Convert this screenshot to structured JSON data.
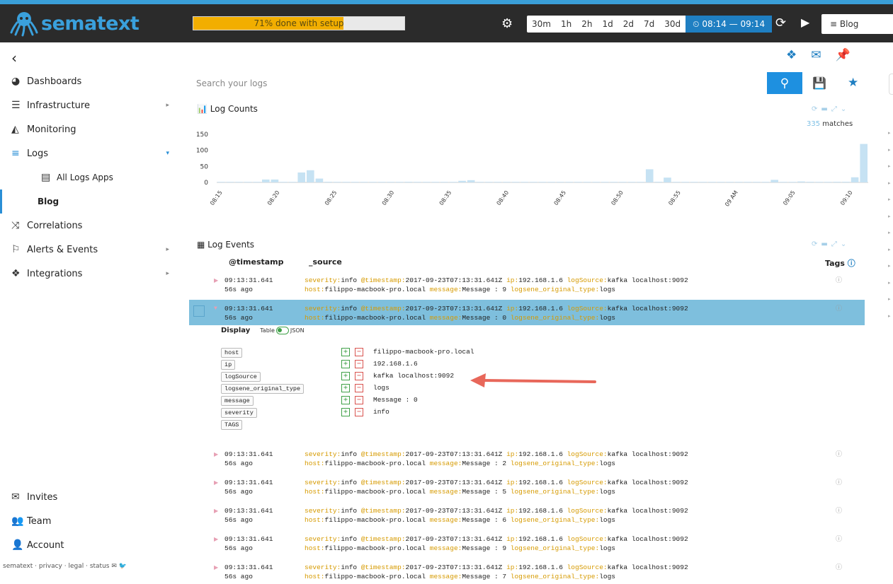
{
  "header": {
    "logo_text": "sematext",
    "setup_progress_text": "71% done with setup",
    "setup_progress_fraction": 0.71,
    "time_ranges": [
      "30m",
      "1h",
      "2h",
      "1d",
      "2d",
      "7d",
      "30d"
    ],
    "active_range": "⏲ 08:14 — 09:14",
    "app_selector": "≡  Blog"
  },
  "sidebar": {
    "back_glyph": "‹",
    "items": [
      {
        "label": "Dashboards",
        "icon": "dashboard-icon"
      },
      {
        "label": "Infrastructure",
        "icon": "server-icon"
      },
      {
        "label": "Monitoring",
        "icon": "area-chart-icon"
      },
      {
        "label": "Logs",
        "icon": "list-icon"
      },
      {
        "label": "All Logs Apps",
        "icon": "table-icon"
      },
      {
        "label": "Blog"
      },
      {
        "label": "Correlations",
        "icon": "shuffle-icon"
      },
      {
        "label": "Alerts & Events",
        "icon": "flag-icon"
      },
      {
        "label": "Integrations",
        "icon": "cubes-icon"
      }
    ],
    "bottom_items": [
      {
        "label": "Invites",
        "icon": "envelope-icon"
      },
      {
        "label": "Team",
        "icon": "users-icon"
      },
      {
        "label": "Account",
        "icon": "user-icon"
      }
    ],
    "footer": "sematext · privacy · legal · status"
  },
  "search": {
    "placeholder": "Search your logs"
  },
  "log_counts": {
    "title": "Log Counts",
    "matches_count": "335",
    "matches_label": " matches"
  },
  "chart_data": {
    "type": "bar",
    "title": "Log Counts",
    "ylim": [
      0,
      150
    ],
    "yticks": [
      0,
      50,
      100,
      150
    ],
    "xtick_labels": [
      "08:15",
      "08:20",
      "08:25",
      "08:30",
      "08:35",
      "08:40",
      "08:45",
      "08:50",
      "08:55",
      "09 AM",
      "09:05",
      "09:10"
    ],
    "values": [
      1,
      1,
      0,
      1,
      0,
      9,
      9,
      0,
      0,
      31,
      38,
      12,
      2,
      0,
      0,
      0,
      1,
      0,
      0,
      1,
      0,
      2,
      0,
      0,
      1,
      0,
      0,
      5,
      7,
      0,
      0,
      0,
      0,
      0,
      0,
      0,
      1,
      0,
      0,
      0,
      0,
      0,
      1,
      0,
      0,
      0,
      0,
      0,
      41,
      2,
      15,
      0,
      0,
      0,
      1,
      0,
      0,
      0,
      0,
      0,
      0,
      0,
      8,
      0,
      0,
      3,
      2,
      0,
      0,
      2,
      2,
      16,
      120
    ],
    "color": "#c6e2f3",
    "grid": false
  },
  "log_events": {
    "title": "Log Events",
    "col_timestamp": "@timestamp",
    "col_source": "_source",
    "col_tags": "Tags",
    "rows": [
      {
        "time": "09:13:31.641",
        "ago": "56s ago",
        "msg": "Message : 9"
      },
      {
        "time": "09:13:31.641",
        "ago": "56s ago",
        "msg": "Message : 0"
      },
      {
        "time": "09:13:31.641",
        "ago": "56s ago",
        "msg": "Message : 2"
      },
      {
        "time": "09:13:31.641",
        "ago": "56s ago",
        "msg": "Message : 5"
      },
      {
        "time": "09:13:31.641",
        "ago": "56s ago",
        "msg": "Message : 6"
      },
      {
        "time": "09:13:31.641",
        "ago": "56s ago",
        "msg": "Message : 9"
      },
      {
        "time": "09:13:31.641",
        "ago": "56s ago",
        "msg": "Message : 7"
      }
    ],
    "source_keys": {
      "severity": "severity:",
      "timestamp": "@timestamp:",
      "ip": "ip:",
      "logSource": "logSource:",
      "host": "host:",
      "message": "message:",
      "original_type": "logsene_original_type:"
    },
    "source_values": {
      "severity": "info",
      "timestamp": "2017-09-23T07:13:31.641Z",
      "ip": "192.168.1.6",
      "logSource": "kafka localhost:9092",
      "host": "filippo-macbook-pro.local",
      "original_type": "logs"
    },
    "display_label": "Display",
    "toggle_table": "Table",
    "toggle_json": "JSON",
    "fields": [
      {
        "name": "host",
        "value": "filippo-macbook-pro.local"
      },
      {
        "name": "ip",
        "value": "192.168.1.6"
      },
      {
        "name": "logSource",
        "value": "kafka localhost:9092"
      },
      {
        "name": "logsene_original_type",
        "value": "logs"
      },
      {
        "name": "message",
        "value": "Message : 0"
      },
      {
        "name": "severity",
        "value": "info"
      },
      {
        "name": "TAGS",
        "value": ""
      }
    ]
  },
  "colors": {
    "accent": "#1f7fc2",
    "arrow": "#e8675a",
    "progress": "#f2ae00"
  }
}
